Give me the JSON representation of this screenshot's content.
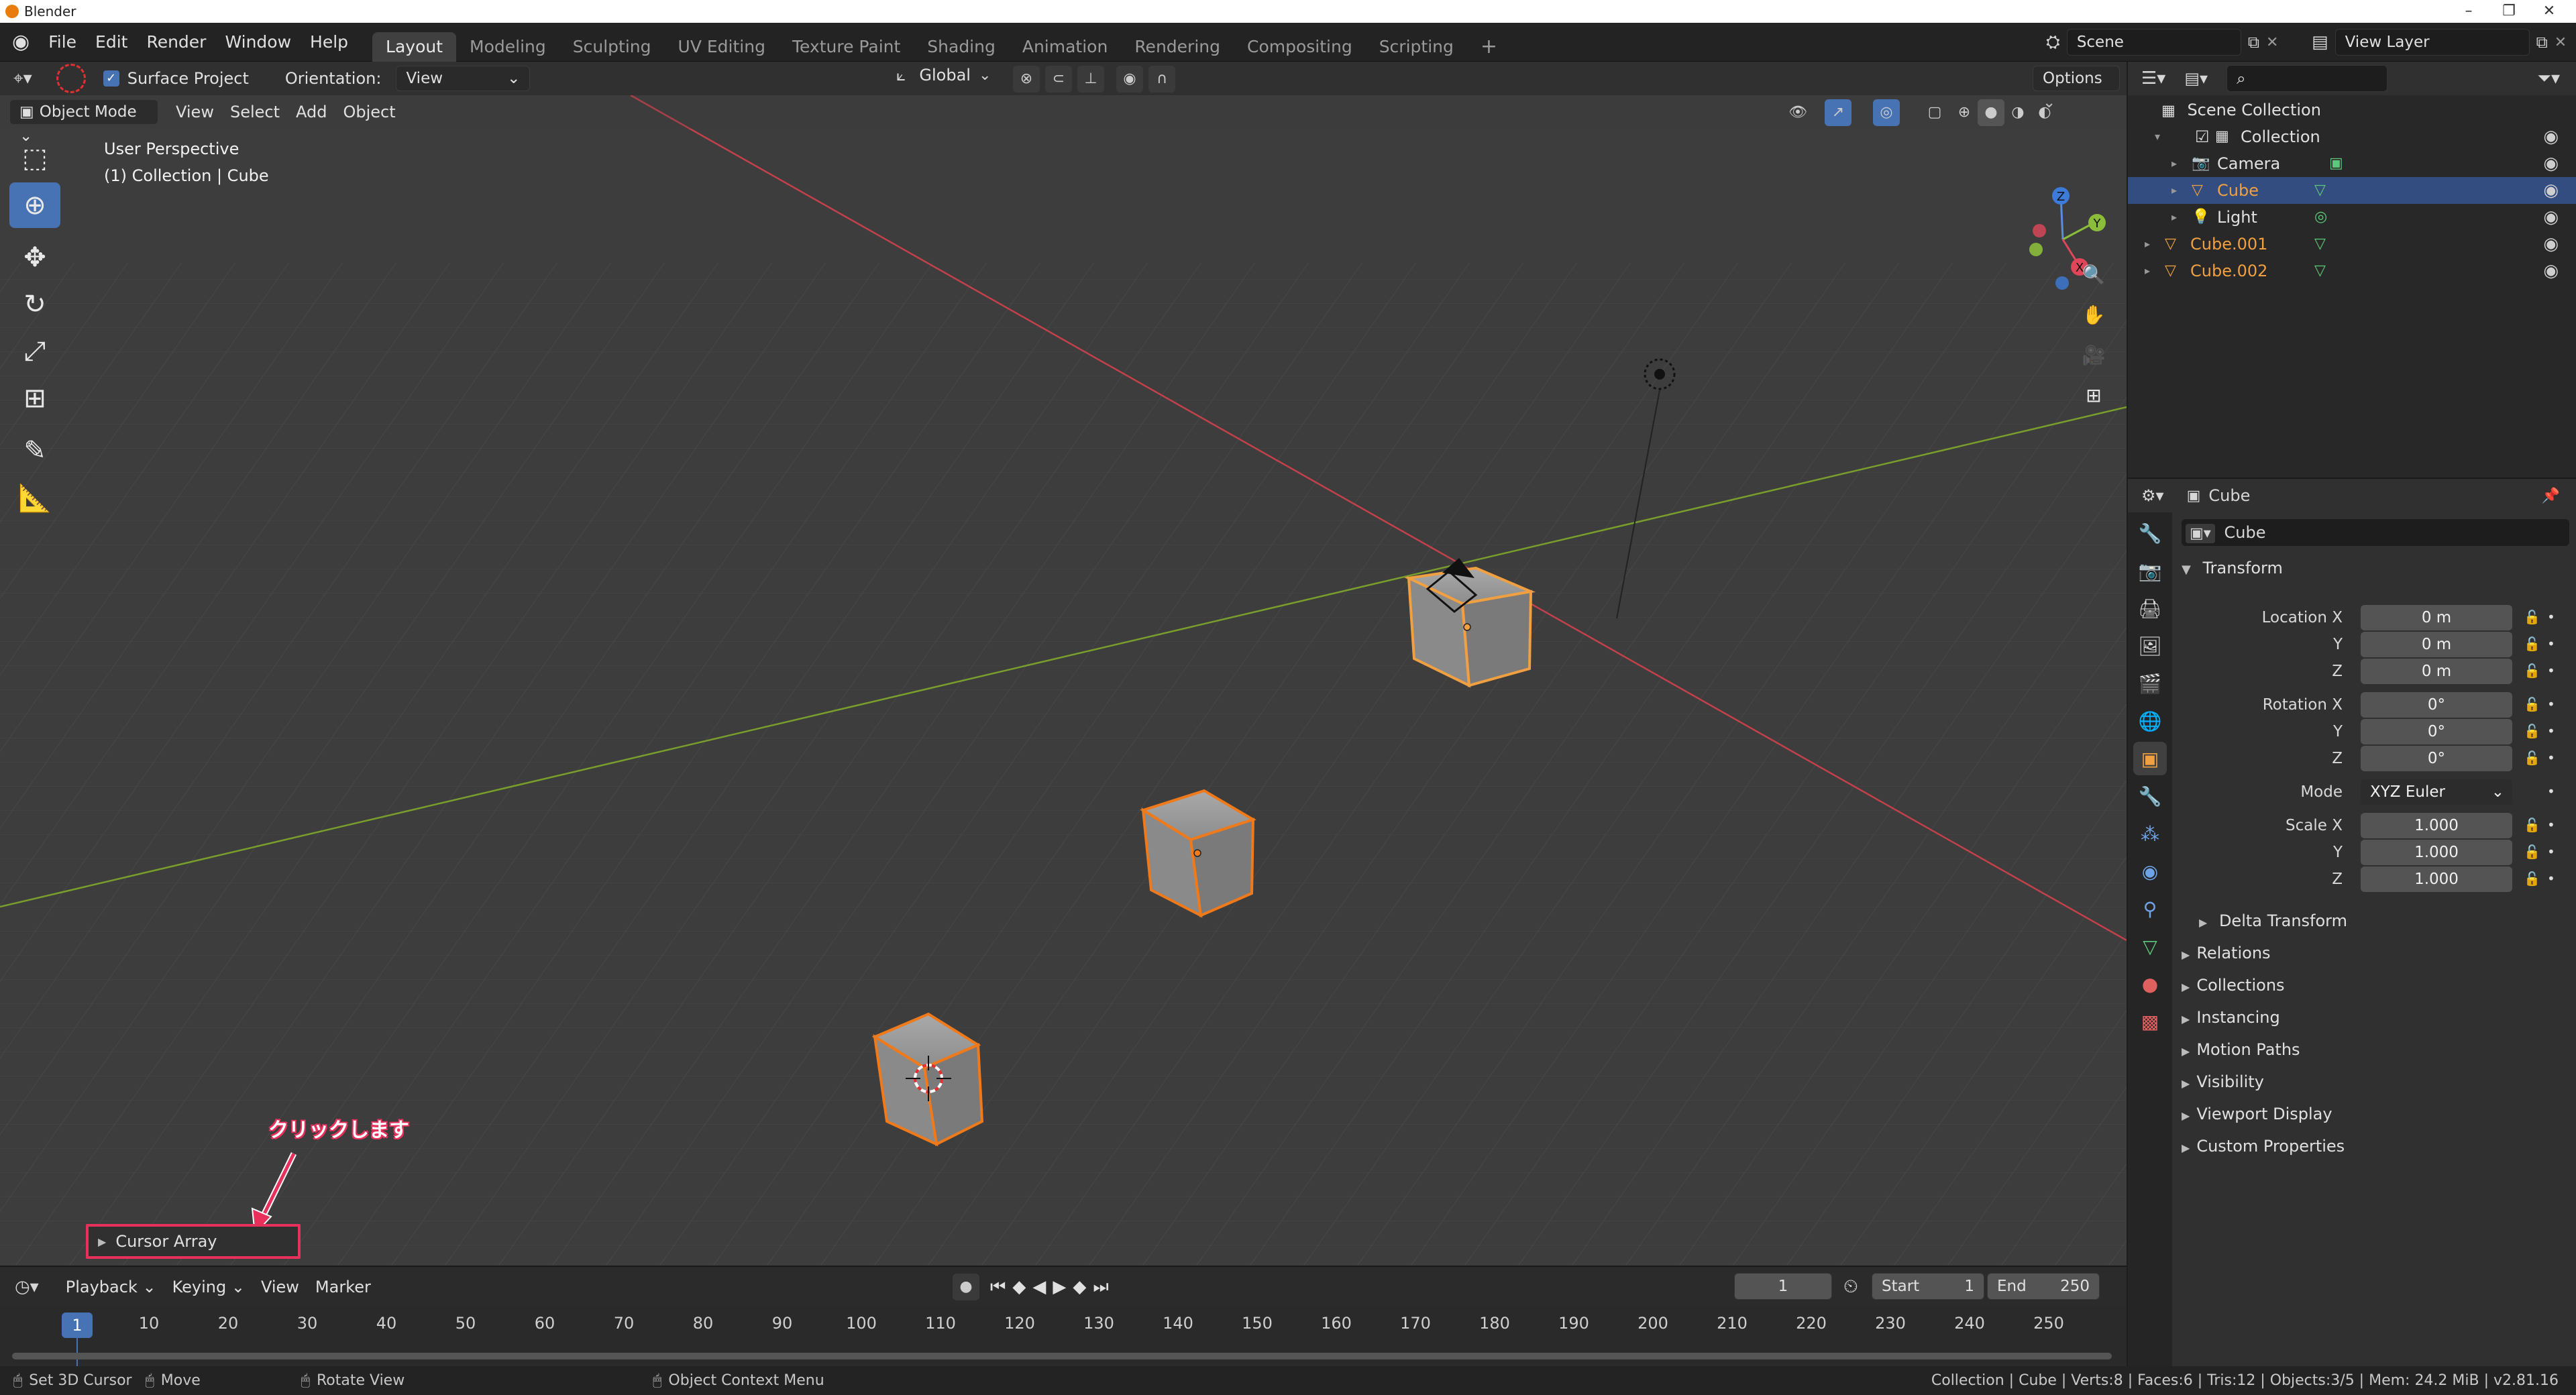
{
  "os_window": {
    "title": "Blender"
  },
  "menu": [
    "File",
    "Edit",
    "Render",
    "Window",
    "Help"
  ],
  "workspaces": [
    "Layout",
    "Modeling",
    "Sculpting",
    "UV Editing",
    "Texture Paint",
    "Shading",
    "Animation",
    "Rendering",
    "Compositing",
    "Scripting"
  ],
  "active_workspace": "Layout",
  "scene": {
    "name": "Scene",
    "view_layer": "View Layer"
  },
  "tool_header": {
    "surface_project_label": "Surface Project",
    "surface_project_checked": true,
    "orientation_label": "Orientation:",
    "orientation_value": "View",
    "transform_orientation": "Global",
    "options_label": "Options"
  },
  "viewport_header": {
    "mode": "Object Mode",
    "menus": [
      "View",
      "Select",
      "Add",
      "Object"
    ]
  },
  "viewport": {
    "perspective_label": "User Perspective",
    "context_label": "(1) Collection | Cube"
  },
  "gizmo": {
    "z": "Z",
    "y": "Y",
    "x": "X"
  },
  "operator_panel": {
    "label": "Cursor Array"
  },
  "annotation": {
    "text": "クリックします"
  },
  "timeline": {
    "menus": [
      "Playback",
      "Keying",
      "View",
      "Marker"
    ],
    "current_frame": "1",
    "start_label": "Start",
    "start_value": "1",
    "end_label": "End",
    "end_value": "250",
    "playhead": "1",
    "ticks": [
      "10",
      "20",
      "30",
      "40",
      "50",
      "60",
      "70",
      "80",
      "90",
      "100",
      "110",
      "120",
      "130",
      "140",
      "150",
      "160",
      "170",
      "180",
      "190",
      "200",
      "210",
      "220",
      "230",
      "240",
      "250"
    ]
  },
  "statusbar": {
    "left_hint": "Set 3D Cursor",
    "middle_hint": "Move",
    "rotate_hint": "Rotate View",
    "context_hint": "Object Context Menu",
    "stats": "Collection | Cube | Verts:8 | Faces:6 | Tris:12 | Objects:3/5 | Mem: 24.2 MiB | v2.81.16"
  },
  "outliner": {
    "root": "Scene Collection",
    "items": [
      {
        "label": "Collection",
        "selected": false,
        "color": "#e0e0e0"
      },
      {
        "label": "Camera",
        "selected": false,
        "color": "#e0e0e0"
      },
      {
        "label": "Cube",
        "selected": true,
        "color": "#f0a040"
      },
      {
        "label": "Light",
        "selected": false,
        "color": "#e0e0e0"
      },
      {
        "label": "Cube.001",
        "selected": false,
        "color": "#f0a040"
      },
      {
        "label": "Cube.002",
        "selected": false,
        "color": "#f0a040"
      }
    ]
  },
  "properties": {
    "header_object": "Cube",
    "object_name": "Cube",
    "transform_title": "Transform",
    "location": {
      "label_x": "Location X",
      "label_y": "Y",
      "label_z": "Z",
      "x": "0 m",
      "y": "0 m",
      "z": "0 m"
    },
    "rotation": {
      "label_x": "Rotation X",
      "label_y": "Y",
      "label_z": "Z",
      "x": "0°",
      "y": "0°",
      "z": "0°"
    },
    "mode_label": "Mode",
    "mode_value": "XYZ Euler",
    "scale": {
      "label_x": "Scale X",
      "label_y": "Y",
      "label_z": "Z",
      "x": "1.000",
      "y": "1.000",
      "z": "1.000"
    },
    "delta_transform": "Delta Transform",
    "sections": [
      "Relations",
      "Collections",
      "Instancing",
      "Motion Paths",
      "Visibility",
      "Viewport Display",
      "Custom Properties"
    ]
  },
  "colors": {
    "accent": "#4772b3",
    "selection_orange": "#f0a040",
    "x_axis": "#c2414b",
    "y_axis": "#7a9e2c",
    "annotation_red": "#e8305c"
  }
}
